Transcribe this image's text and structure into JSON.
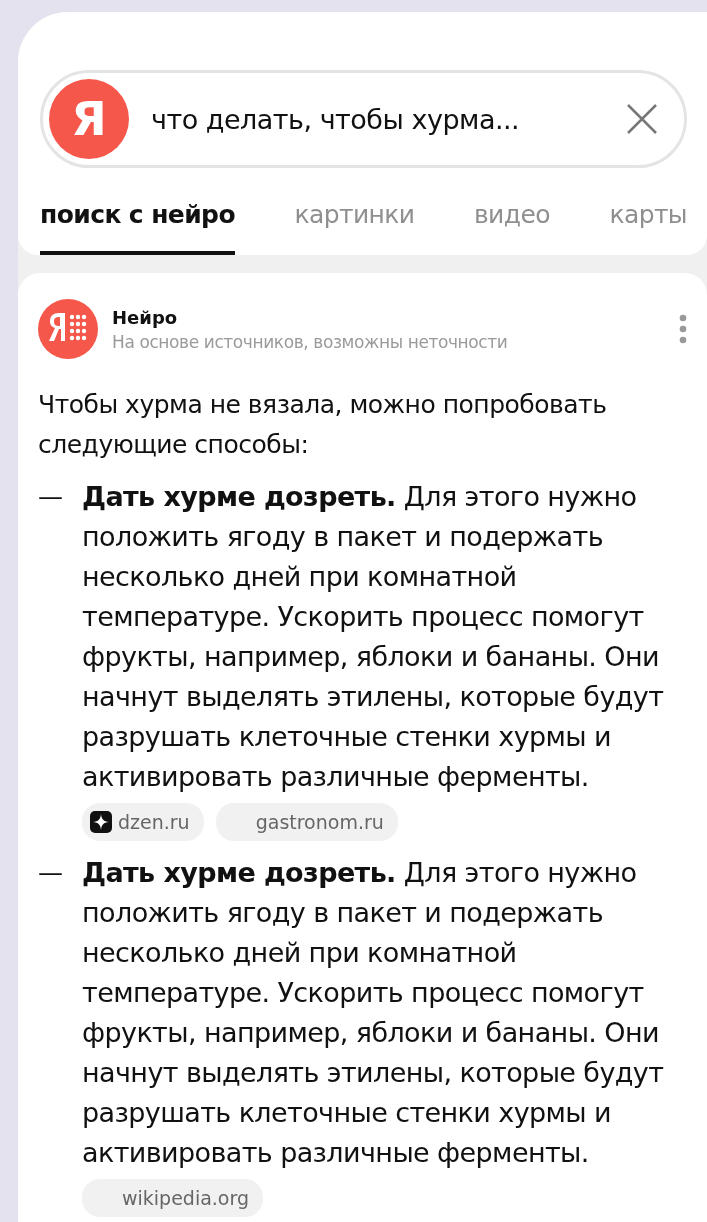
{
  "search": {
    "value": "что делать, чтобы хурма...",
    "logo": "Я"
  },
  "tabs": [
    {
      "label": "поиск с нейро",
      "selected": true
    },
    {
      "label": "картинки",
      "selected": false
    },
    {
      "label": "видео",
      "selected": false
    },
    {
      "label": "карты",
      "selected": false
    }
  ],
  "answer": {
    "source_name": "Нейро",
    "disclaimer": "На основе источников, возможны неточности",
    "intro": "Чтобы хурма не вязала, можно попробовать следующие способы:",
    "items": [
      {
        "marker": "—",
        "text": "**Дать хурме дозреть.** Для этого нужно положить ягоду в пакет и подержать несколько дней при комнатной температуре. Ускорить процесс помогут фрукты, например, яблоки и бананы. Они начнут выделять этилены, которые будут разрушать клеточные стенки хурмы и активировать различные ферменты.",
        "sources": [
          {
            "label": "dzen.ru",
            "has_icon": true
          },
          {
            "label": "gastronom.ru",
            "has_icon": false
          }
        ]
      },
      {
        "marker": "—",
        "text": "**Дать хурме дозреть.** Для этого нужно положить ягоду в пакет и подержать несколько дней при комнатной температуре. Ускорить процесс помогут фрукты, например, яблоки и бананы. Они начнут выделять этилены, которые будут разрушать клеточные стенки хурмы и активировать различные ферменты.",
        "sources": [
          {
            "label": "wikipedia.org",
            "has_icon": false
          }
        ]
      }
    ]
  }
}
